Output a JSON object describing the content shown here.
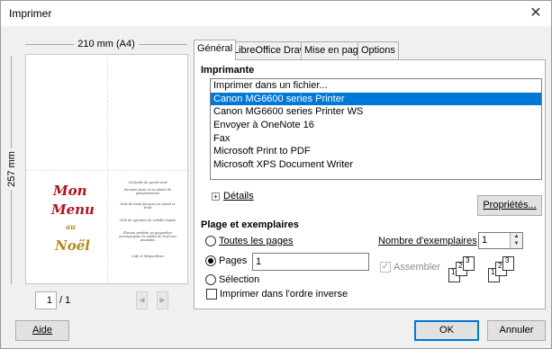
{
  "window": {
    "title": "Imprimer",
    "close_glyph": "✕"
  },
  "preview": {
    "width_label": "210 mm (A4)",
    "height_label": "257 mm",
    "menu": {
      "words": [
        "Mon",
        "Menu",
        "au",
        "Noël"
      ],
      "lines": [
        "Cocktails du grand nord",
        "Saumon fumé et sa salade de pamplemousse",
        "Noix de Saint-Jacques en chaud et froid",
        "Chili de agrumes de volaille laquée",
        "Plateau parfaite au gingembre accompagnée de sablés de Noël aux amandes",
        "Café et Mignardises"
      ]
    },
    "page_current": "1",
    "page_total": "/ 1",
    "prev_icon": "◀",
    "next_icon": "▶"
  },
  "tabs": [
    {
      "label": "Général",
      "active": true
    },
    {
      "label": "LibreOffice Draw",
      "active": false
    },
    {
      "label": "Mise en page",
      "active": false
    },
    {
      "label": "Options",
      "active": false
    }
  ],
  "printer_section": {
    "heading": "Imprimante",
    "printers": [
      "Imprimer dans un fichier...",
      "Canon MG6600 series Printer",
      "Canon MG6600 series Printer WS",
      "Envoyer à OneNote 16",
      "Fax",
      "Microsoft Print to PDF",
      "Microsoft XPS Document Writer"
    ],
    "selected_index": 1,
    "details_plus": "+",
    "details_label": "Détails",
    "properties_button": "Propriétés..."
  },
  "range_section": {
    "heading": "Plage et exemplaires",
    "all_pages_label": "Toutes les pages",
    "pages_label": "Pages",
    "pages_value": "1",
    "selection_label": "Sélection",
    "reverse_label": "Imprimer dans l'ordre inverse",
    "copies_label": "Nombre d'exemplaires",
    "copies_value": "1",
    "collate_label": "Assembler",
    "collate_check": "✓",
    "spin_up": "▲",
    "spin_down": "▼",
    "collate_digits": [
      "1",
      "2",
      "3"
    ]
  },
  "footer": {
    "help_button": "Aide",
    "ok_button": "OK",
    "cancel_button": "Annuler"
  },
  "colors": {
    "selection": "#0078d7",
    "menu_red": "#b3141d",
    "menu_gold": "#b88a1c"
  }
}
